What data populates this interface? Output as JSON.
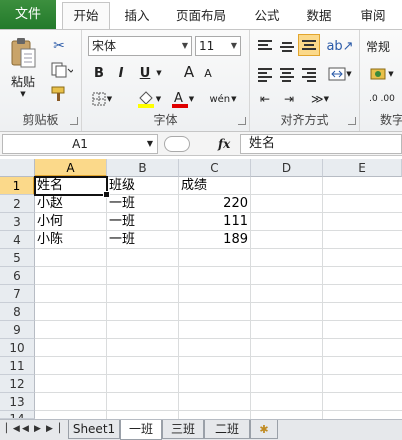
{
  "ribbon_tabs": [
    "文件",
    "开始",
    "插入",
    "页面布局",
    "公式",
    "数据",
    "审阅"
  ],
  "ribbon": {
    "clipboard": {
      "paste_label": "粘贴",
      "group_label": "剪贴板"
    },
    "font": {
      "font_name": "宋体",
      "font_size": "11",
      "group_label": "字体",
      "bold": "B",
      "italic": "I",
      "underline": "U",
      "grow": "A",
      "shrink": "A",
      "phonetic": "wén"
    },
    "alignment": {
      "group_label": "对齐方式"
    },
    "number": {
      "format": "常规",
      "group_label": "数字"
    }
  },
  "formula_bar": {
    "name_box": "A1",
    "fx": "fx",
    "content": "姓名"
  },
  "columns": [
    "A",
    "B",
    "C",
    "D",
    "E"
  ],
  "rows": [
    "1",
    "2",
    "3",
    "4",
    "5",
    "6",
    "7",
    "8",
    "9",
    "10",
    "11",
    "12",
    "13",
    "14"
  ],
  "cells": {
    "A1": "姓名",
    "B1": "班级",
    "C1": "成绩",
    "A2": "小赵",
    "B2": "一班",
    "C2": "220",
    "A3": "小何",
    "B3": "一班",
    "C3": "111",
    "A4": "小陈",
    "B4": "一班",
    "C4": "189"
  },
  "sheet_tabs": [
    "Sheet1",
    "一班",
    "三班",
    "二班"
  ],
  "active_sheet": "一班",
  "colors": {
    "file_tab": "#2e7d32",
    "selection_header": "#fbd98a",
    "grid_line": "#dadcdd"
  }
}
